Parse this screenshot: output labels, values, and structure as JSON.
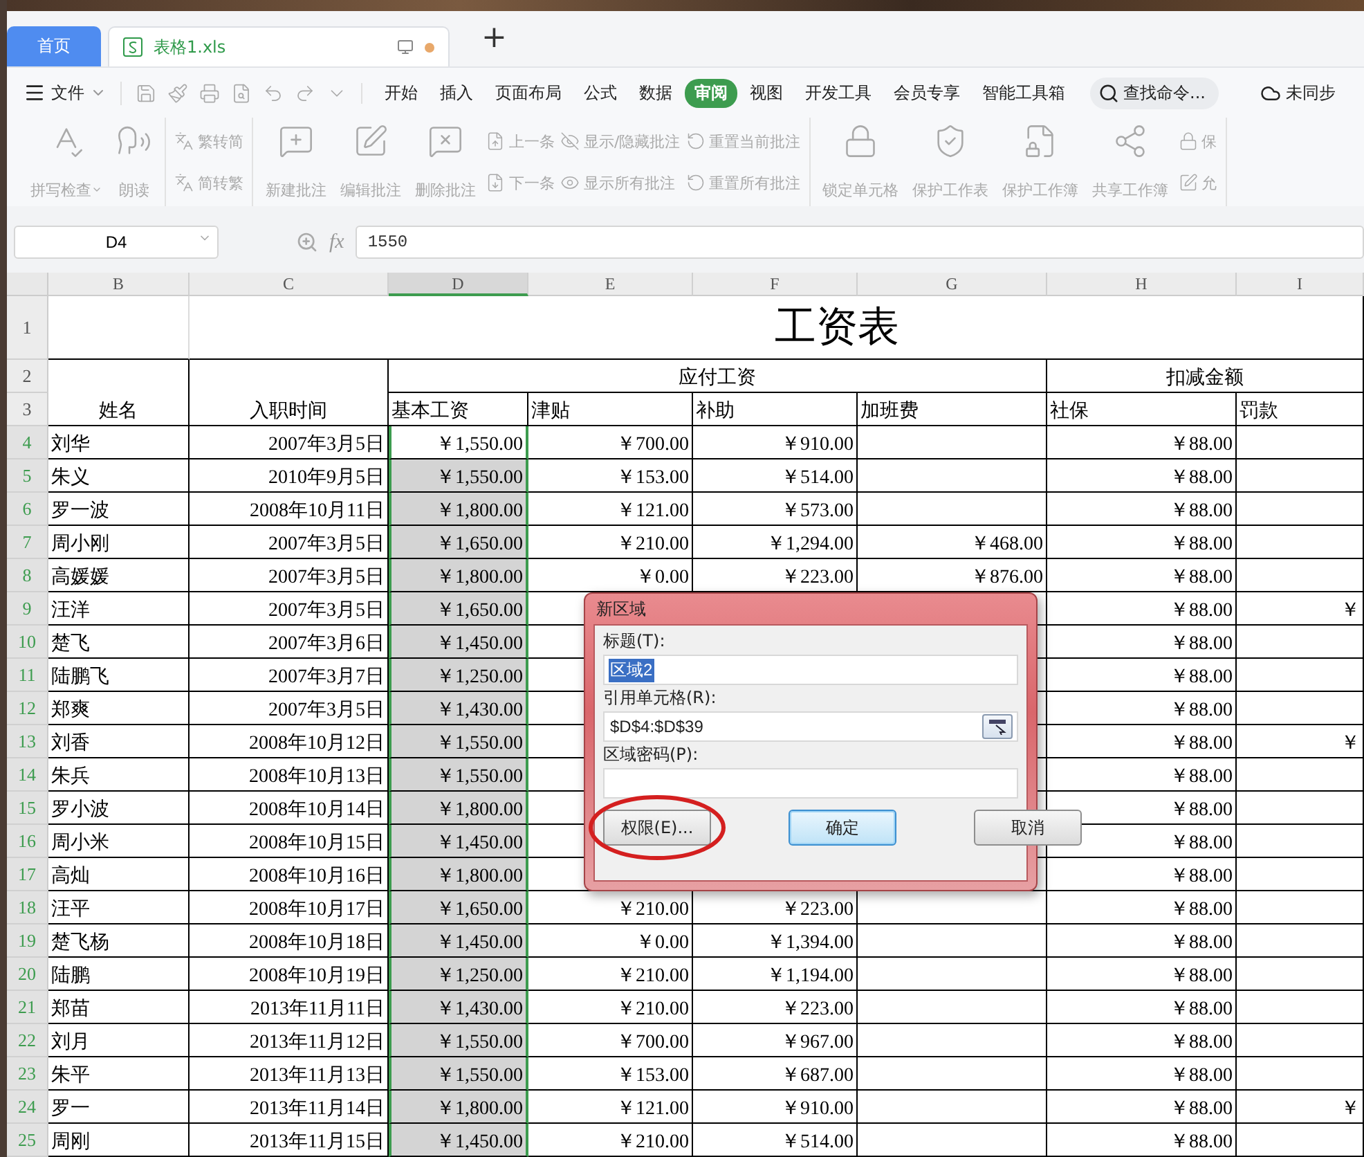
{
  "tabs": [
    {
      "label": "首页",
      "kind": "home",
      "selected": false
    },
    {
      "label": "表格1.xls",
      "kind": "doc",
      "selected": true,
      "modified": true
    }
  ],
  "new_tab": "+",
  "menu": {
    "file": "文件",
    "tabs": [
      {
        "label": "开始",
        "selected": false
      },
      {
        "label": "插入",
        "selected": false
      },
      {
        "label": "页面布局",
        "selected": false
      },
      {
        "label": "公式",
        "selected": false
      },
      {
        "label": "数据",
        "selected": false
      },
      {
        "label": "审阅",
        "selected": true
      },
      {
        "label": "视图",
        "selected": false
      },
      {
        "label": "开发工具",
        "selected": false
      },
      {
        "label": "会员专享",
        "selected": false
      },
      {
        "label": "智能工具箱",
        "selected": false
      }
    ],
    "search_placeholder": "查找命令...",
    "sync": "未同步"
  },
  "ribbon": [
    {
      "items": [
        {
          "kind": "large",
          "label": "拼写检查",
          "dropdown": true,
          "disabled": true
        },
        {
          "kind": "large",
          "label": "朗读",
          "dropdown": false,
          "disabled": true
        }
      ]
    },
    {
      "items": [
        {
          "kind": "small",
          "label": "繁转简",
          "disabled": true
        },
        {
          "kind": "small",
          "label": "简转繁",
          "disabled": true
        }
      ]
    },
    {
      "items": [
        {
          "kind": "large",
          "label": "新建批注",
          "dropdown": false,
          "disabled": true
        },
        {
          "kind": "large",
          "label": "编辑批注",
          "dropdown": false,
          "disabled": true
        },
        {
          "kind": "large",
          "label": "删除批注",
          "dropdown": false,
          "disabled": true
        },
        {
          "kind": "small",
          "label": "上一条",
          "disabled": true
        },
        {
          "kind": "small",
          "label": "下一条",
          "disabled": true
        },
        {
          "kind": "small",
          "label": "显示/隐藏批注",
          "disabled": true
        },
        {
          "kind": "small",
          "label": "显示所有批注",
          "disabled": true
        },
        {
          "kind": "small",
          "label": "重置当前批注",
          "disabled": true
        },
        {
          "kind": "small",
          "label": "重置所有批注",
          "disabled": true
        }
      ]
    },
    {
      "items": [
        {
          "kind": "large",
          "label": "锁定单元格",
          "dropdown": false,
          "disabled": true
        },
        {
          "kind": "large",
          "label": "保护工作表",
          "dropdown": false,
          "disabled": true
        },
        {
          "kind": "large",
          "label": "保护工作簿",
          "dropdown": false,
          "disabled": true
        },
        {
          "kind": "large",
          "label": "共享工作簿",
          "dropdown": false,
          "disabled": true
        },
        {
          "kind": "small",
          "label": "保",
          "disabled": true
        },
        {
          "kind": "small",
          "label": "允",
          "disabled": true
        }
      ]
    }
  ],
  "formula_bar": {
    "name_box": "D4",
    "fx": "fx",
    "value": "1550"
  },
  "sheet": {
    "columns": [
      {
        "label": "B",
        "selected": false
      },
      {
        "label": "C",
        "selected": false
      },
      {
        "label": "D",
        "selected": true
      },
      {
        "label": "E",
        "selected": false
      },
      {
        "label": "F",
        "selected": false
      },
      {
        "label": "G",
        "selected": false
      },
      {
        "label": "H",
        "selected": false
      },
      {
        "label": "I",
        "selected": false
      }
    ],
    "title_row": {
      "num": "1",
      "title": "工资表"
    },
    "group_row": {
      "num": "2",
      "name": "姓名",
      "hire_date": "入职时间",
      "payable": "应付工资",
      "deductions": "扣减金额"
    },
    "sub_row": {
      "num": "3",
      "headers": [
        "基本工资",
        "津贴",
        "补助",
        "加班费",
        "社保",
        "罚款"
      ]
    },
    "rows": [
      {
        "num": "4",
        "selected": true,
        "active": true,
        "name": "刘华",
        "hire_date": "2007年3月5日",
        "basic": "￥1,550.00",
        "allowance": "￥700.00",
        "subsidy": "￥910.00",
        "social": "￥88.00"
      },
      {
        "num": "5",
        "selected": true,
        "active": false,
        "name": "朱义",
        "hire_date": "2010年9月5日",
        "basic": "￥1,550.00",
        "allowance": "￥153.00",
        "subsidy": "￥514.00",
        "social": "￥88.00"
      },
      {
        "num": "6",
        "selected": true,
        "active": false,
        "name": "罗一波",
        "hire_date": "2008年10月11日",
        "basic": "￥1,800.00",
        "allowance": "￥121.00",
        "subsidy": "￥573.00",
        "social": "￥88.00"
      },
      {
        "num": "7",
        "selected": true,
        "active": false,
        "name": "周小刚",
        "hire_date": "2007年3月5日",
        "basic": "￥1,650.00",
        "allowance": "￥210.00",
        "subsidy": "￥1,294.00",
        "overtime": "￥468.00",
        "social": "￥88.00"
      },
      {
        "num": "8",
        "selected": true,
        "active": false,
        "name": "高媛媛",
        "hire_date": "2007年3月5日",
        "basic": "￥1,800.00",
        "allowance": "￥0.00",
        "subsidy": "￥223.00",
        "overtime": "￥876.00",
        "social": "￥88.00"
      },
      {
        "num": "9",
        "selected": true,
        "active": false,
        "name": "汪洋",
        "hire_date": "2007年3月5日",
        "basic": "￥1,650.00",
        "social": "￥88.00",
        "fine": "￥"
      },
      {
        "num": "10",
        "selected": true,
        "active": false,
        "name": "楚飞",
        "hire_date": "2007年3月6日",
        "basic": "￥1,450.00",
        "social": "￥88.00"
      },
      {
        "num": "11",
        "selected": true,
        "active": false,
        "name": "陆鹏飞",
        "hire_date": "2007年3月7日",
        "basic": "￥1,250.00",
        "social": "￥88.00"
      },
      {
        "num": "12",
        "selected": true,
        "active": false,
        "name": "郑爽",
        "hire_date": "2007年3月5日",
        "basic": "￥1,430.00",
        "social": "￥88.00"
      },
      {
        "num": "13",
        "selected": true,
        "active": false,
        "name": "刘香",
        "hire_date": "2008年10月12日",
        "basic": "￥1,550.00",
        "social": "￥88.00",
        "fine": "￥"
      },
      {
        "num": "14",
        "selected": true,
        "active": false,
        "name": "朱兵",
        "hire_date": "2008年10月13日",
        "basic": "￥1,550.00",
        "social": "￥88.00"
      },
      {
        "num": "15",
        "selected": true,
        "active": false,
        "name": "罗小波",
        "hire_date": "2008年10月14日",
        "basic": "￥1,800.00",
        "social": "￥88.00"
      },
      {
        "num": "16",
        "selected": true,
        "active": false,
        "name": "周小米",
        "hire_date": "2008年10月15日",
        "basic": "￥1,450.00",
        "social": "￥88.00"
      },
      {
        "num": "17",
        "selected": true,
        "active": false,
        "name": "高灿",
        "hire_date": "2008年10月16日",
        "basic": "￥1,800.00",
        "social": "￥88.00"
      },
      {
        "num": "18",
        "selected": true,
        "active": false,
        "name": "汪平",
        "hire_date": "2008年10月17日",
        "basic": "￥1,650.00",
        "allowance": "￥210.00",
        "subsidy": "￥223.00",
        "social": "￥88.00"
      },
      {
        "num": "19",
        "selected": true,
        "active": false,
        "name": "楚飞杨",
        "hire_date": "2008年10月18日",
        "basic": "￥1,450.00",
        "allowance": "￥0.00",
        "subsidy": "￥1,394.00",
        "social": "￥88.00"
      },
      {
        "num": "20",
        "selected": true,
        "active": false,
        "name": "陆鹏",
        "hire_date": "2008年10月19日",
        "basic": "￥1,250.00",
        "allowance": "￥210.00",
        "subsidy": "￥1,194.00",
        "social": "￥88.00"
      },
      {
        "num": "21",
        "selected": true,
        "active": false,
        "name": "郑苗",
        "hire_date": "2013年11月11日",
        "basic": "￥1,430.00",
        "allowance": "￥210.00",
        "subsidy": "￥223.00",
        "social": "￥88.00"
      },
      {
        "num": "22",
        "selected": true,
        "active": false,
        "name": "刘月",
        "hire_date": "2013年11月12日",
        "basic": "￥1,550.00",
        "allowance": "￥700.00",
        "subsidy": "￥967.00",
        "social": "￥88.00"
      },
      {
        "num": "23",
        "selected": true,
        "active": false,
        "name": "朱平",
        "hire_date": "2013年11月13日",
        "basic": "￥1,550.00",
        "allowance": "￥153.00",
        "subsidy": "￥687.00",
        "social": "￥88.00"
      },
      {
        "num": "24",
        "selected": true,
        "active": false,
        "name": "罗一",
        "hire_date": "2013年11月14日",
        "basic": "￥1,800.00",
        "allowance": "￥121.00",
        "subsidy": "￥910.00",
        "social": "￥88.00",
        "fine": "￥"
      },
      {
        "num": "25",
        "selected": true,
        "active": false,
        "name": "周刚",
        "hire_date": "2013年11月15日",
        "basic": "￥1,450.00",
        "allowance": "￥210.00",
        "subsidy": "￥514.00",
        "social": "￥88.00"
      }
    ]
  },
  "dialog": {
    "title": "新区域",
    "fields": [
      {
        "label": "标题(T):",
        "value": "区域2",
        "selected_text": true,
        "picker": false
      },
      {
        "label": "引用单元格(R):",
        "value": "$D$4:$D$39",
        "selected_text": false,
        "picker": true
      },
      {
        "label": "区域密码(P):",
        "selected_text": false,
        "picker": false
      }
    ],
    "buttons": [
      {
        "label": "权限(E)...",
        "default": false,
        "circled": true
      },
      {
        "label": "确定",
        "default": true,
        "circled": false
      },
      {
        "label": "取消",
        "default": false,
        "circled": false
      }
    ]
  }
}
